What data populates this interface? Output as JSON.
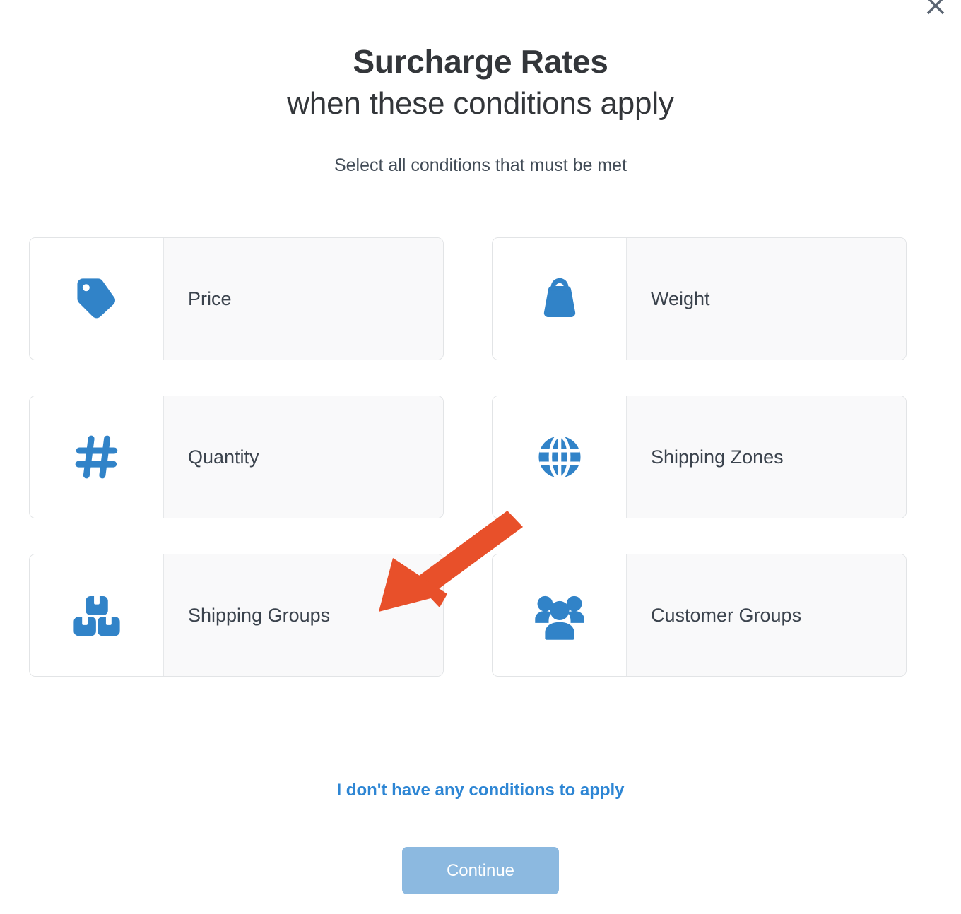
{
  "dialog": {
    "title_main": "Surcharge Rates",
    "title_sub": "when these conditions apply",
    "subtitle": "Select all conditions that must be met",
    "close_icon": "close-icon"
  },
  "conditions": [
    {
      "label": "Price",
      "icon": "price-tag-icon"
    },
    {
      "label": "Weight",
      "icon": "weight-icon"
    },
    {
      "label": "Quantity",
      "icon": "hash-icon"
    },
    {
      "label": "Shipping Zones",
      "icon": "globe-icon"
    },
    {
      "label": "Shipping Groups",
      "icon": "boxes-icon"
    },
    {
      "label": "Customer Groups",
      "icon": "people-group-icon"
    }
  ],
  "footer": {
    "skip_link": "I don't have any conditions to apply",
    "continue_label": "Continue"
  },
  "annotation": {
    "type": "arrow",
    "points_to": "Shipping Groups",
    "color": "#e8502a"
  },
  "colors": {
    "icon_blue": "#3183c8",
    "link_blue": "#2e86d4",
    "button_disabled_blue": "#8cb9e0",
    "heading": "#33363a",
    "label": "#3b434d",
    "card_border": "#e2e4e6",
    "card_label_bg": "#f9f9fa",
    "close_gray": "#5b6572"
  }
}
